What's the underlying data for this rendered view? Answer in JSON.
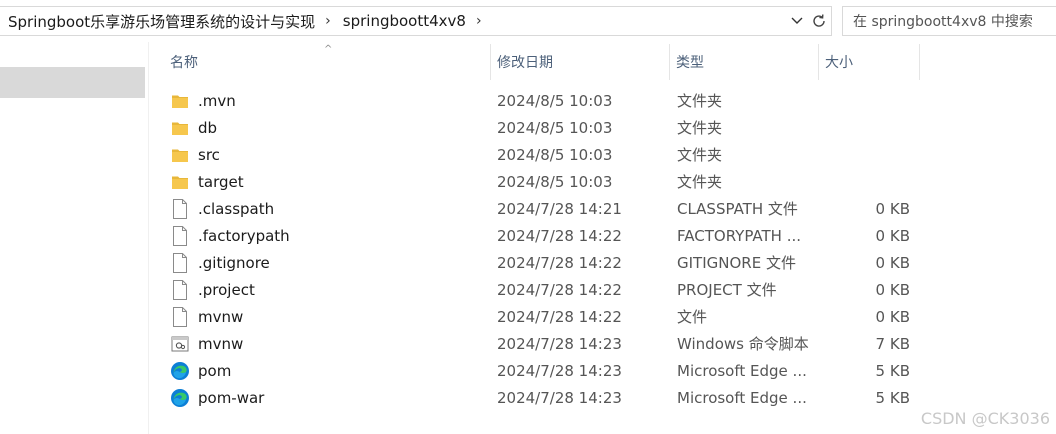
{
  "breadcrumb": {
    "items": [
      "Springboot乐享游乐场管理系统的设计与实现",
      "springboott4xv8"
    ]
  },
  "search": {
    "placeholder": "在 springboott4xv8 中搜索"
  },
  "columns": {
    "name": "名称",
    "date": "修改日期",
    "type": "类型",
    "size": "大小"
  },
  "files": [
    {
      "name": ".mvn",
      "date": "2024/8/5 10:03",
      "type": "文件夹",
      "size": "",
      "icon": "folder-icon"
    },
    {
      "name": "db",
      "date": "2024/8/5 10:03",
      "type": "文件夹",
      "size": "",
      "icon": "folder-icon"
    },
    {
      "name": "src",
      "date": "2024/8/5 10:03",
      "type": "文件夹",
      "size": "",
      "icon": "folder-icon"
    },
    {
      "name": "target",
      "date": "2024/8/5 10:03",
      "type": "文件夹",
      "size": "",
      "icon": "folder-icon"
    },
    {
      "name": ".classpath",
      "date": "2024/7/28 14:21",
      "type": "CLASSPATH 文件",
      "size": "0 KB",
      "icon": "file-icon"
    },
    {
      "name": ".factorypath",
      "date": "2024/7/28 14:22",
      "type": "FACTORYPATH ...",
      "size": "0 KB",
      "icon": "file-icon"
    },
    {
      "name": ".gitignore",
      "date": "2024/7/28 14:22",
      "type": "GITIGNORE 文件",
      "size": "0 KB",
      "icon": "file-icon"
    },
    {
      "name": ".project",
      "date": "2024/7/28 14:22",
      "type": "PROJECT 文件",
      "size": "0 KB",
      "icon": "file-icon"
    },
    {
      "name": "mvnw",
      "date": "2024/7/28 14:22",
      "type": "文件",
      "size": "0 KB",
      "icon": "file-icon"
    },
    {
      "name": "mvnw",
      "date": "2024/7/28 14:23",
      "type": "Windows 命令脚本",
      "size": "7 KB",
      "icon": "script-icon"
    },
    {
      "name": "pom",
      "date": "2024/7/28 14:23",
      "type": "Microsoft Edge ...",
      "size": "5 KB",
      "icon": "edge-icon"
    },
    {
      "name": "pom-war",
      "date": "2024/7/28 14:23",
      "type": "Microsoft Edge ...",
      "size": "5 KB",
      "icon": "edge-icon"
    }
  ],
  "watermark": "CSDN @CK3036"
}
